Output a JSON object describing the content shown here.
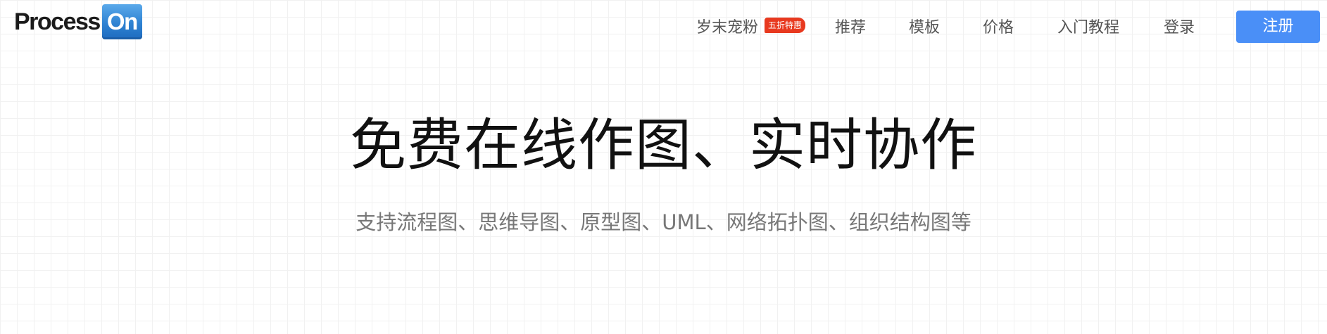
{
  "header": {
    "logo": {
      "text_process": "Process",
      "text_on": "On"
    },
    "nav": {
      "promo_label": "岁末宠粉",
      "promo_badge": "五折特惠",
      "recommend": "推荐",
      "templates": "模板",
      "pricing": "价格",
      "tutorial": "入门教程",
      "login": "登录",
      "register": "注册"
    }
  },
  "hero": {
    "title": "免费在线作图、实时协作",
    "subtitle": "支持流程图、思维导图、原型图、UML、网络拓扑图、组织结构图等"
  },
  "colors": {
    "accent": "#4a8ff7",
    "badge": "#e8391f",
    "logo_blue": "#2e82d2"
  }
}
